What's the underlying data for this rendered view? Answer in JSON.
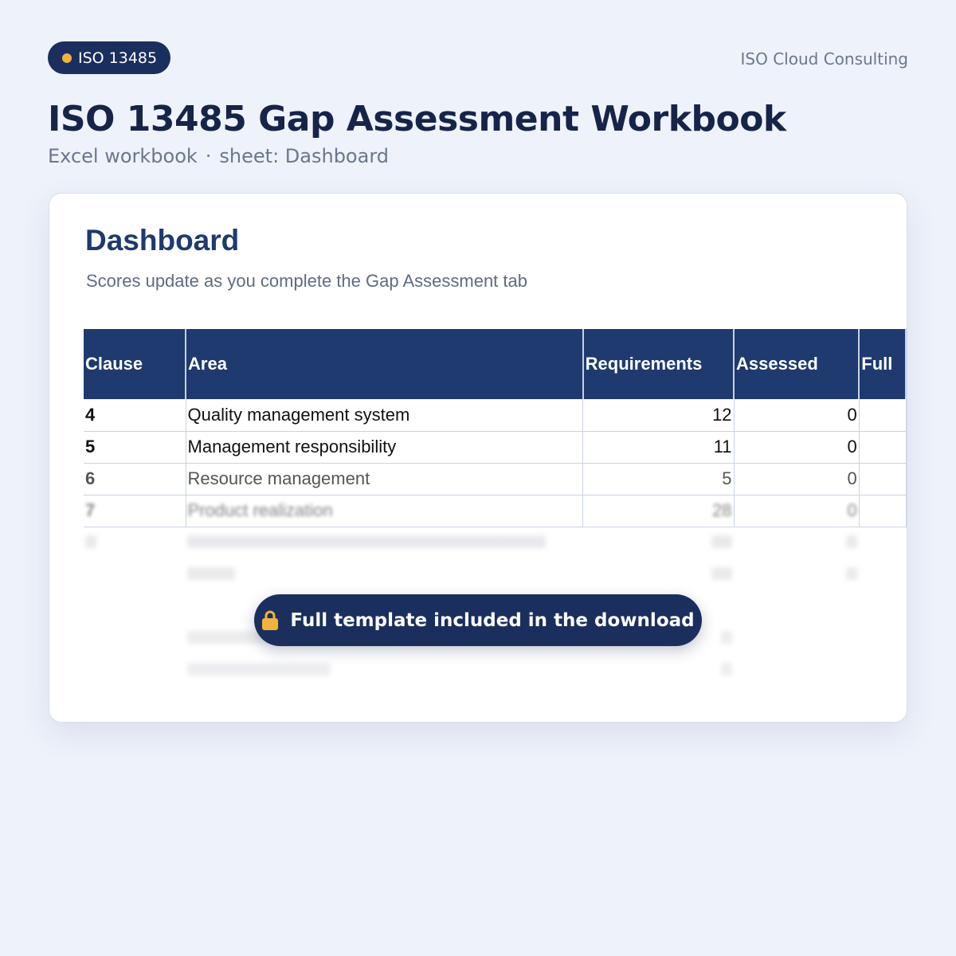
{
  "badge": {
    "label": "ISO 13485"
  },
  "brand": "ISO Cloud Consulting",
  "header": {
    "title": "ISO 13485 Gap Assessment Workbook",
    "file_type": "Excel workbook",
    "separator": "·",
    "sheet": "sheet: Dashboard"
  },
  "sheet": {
    "title": "Dashboard",
    "subtitle": "Scores update as you complete the Gap Assessment tab",
    "columns": [
      "Clause",
      "Area",
      "Requirements",
      "Assessed",
      "Full"
    ],
    "rows": [
      {
        "clause": "4",
        "area": "Quality management system",
        "requirements": "12",
        "assessed": "0"
      },
      {
        "clause": "5",
        "area": "Management responsibility",
        "requirements": "11",
        "assessed": "0"
      },
      {
        "clause": "6",
        "area": "Resource management",
        "requirements": "5",
        "assessed": "0"
      },
      {
        "clause": "7",
        "area": "Product realization",
        "requirements": "28",
        "assessed": "0"
      }
    ]
  },
  "cta": {
    "label": "Full template included in the download"
  },
  "colors": {
    "background": "#eef2fa",
    "navy": "#1b2f5e",
    "header_fill": "#1e3a6e",
    "accent": "#f2b33d"
  },
  "icons": {
    "badge_dot": "dot-icon",
    "cta": "lock-icon"
  }
}
